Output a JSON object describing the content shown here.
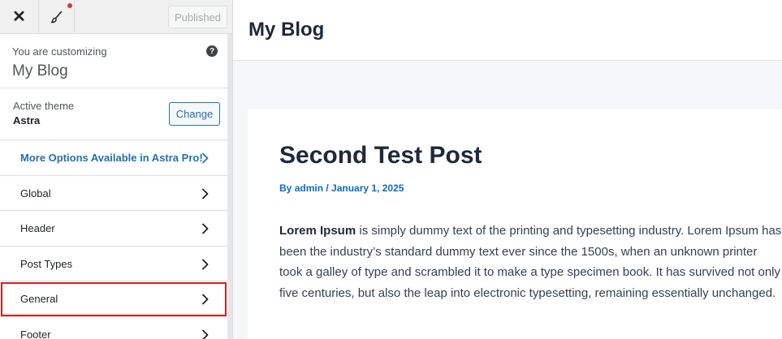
{
  "sidebar": {
    "published_label": "Published",
    "customizing_label": "You are customizing",
    "site_name": "My Blog",
    "help_glyph": "?",
    "active_theme_label": "Active theme",
    "theme_name": "Astra",
    "change_label": "Change",
    "items": [
      {
        "label": "More Options Available in Astra Pro!",
        "kind": "pro"
      },
      {
        "label": "Global",
        "kind": "normal"
      },
      {
        "label": "Header",
        "kind": "normal"
      },
      {
        "label": "Post Types",
        "kind": "normal"
      },
      {
        "label": "General",
        "kind": "highlight"
      },
      {
        "label": "Footer",
        "kind": "normal"
      }
    ]
  },
  "preview": {
    "site_title": "My Blog",
    "post_title": "Second Test Post",
    "meta_prefix": "By ",
    "author": "admin",
    "separator": " / ",
    "date": "January 1, 2025",
    "body_lead": "Lorem Ipsum",
    "body_text": " is simply dummy text of the printing and typesetting industry. Lorem Ipsum has been the industry’s standard dummy text ever since the 1500s, when an unknown printer took a galley of type and scrambled it to make a type specimen book. It has survived not only five centuries, but also the leap into electronic typesetting, remaining essentially unchanged."
  },
  "colors": {
    "accent": "#2271b1",
    "highlight_border": "#d81e1e",
    "notification_dot": "#d63638",
    "meta_link": "#0b6bcb"
  }
}
